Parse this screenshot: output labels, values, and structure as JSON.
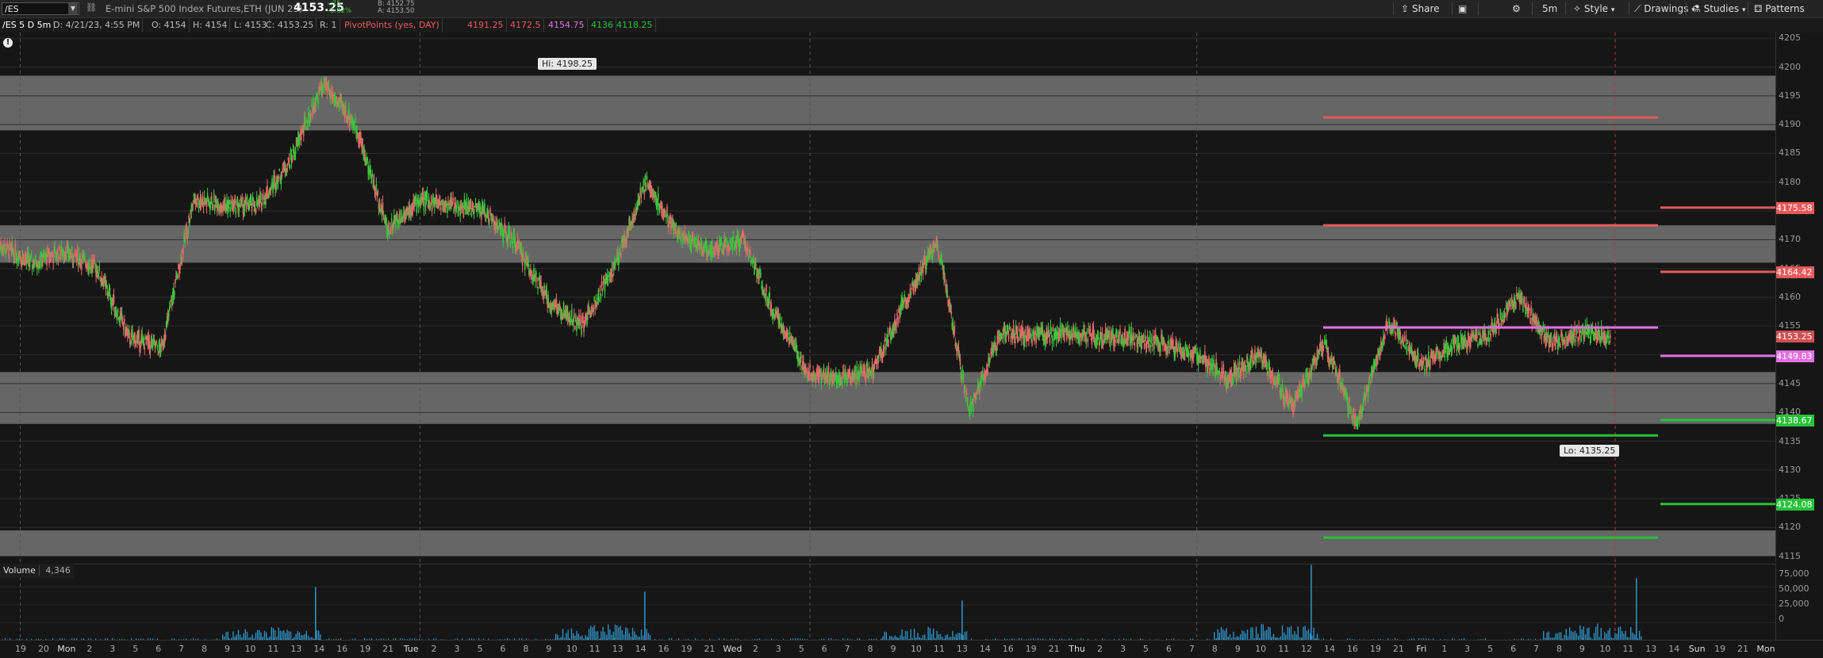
{
  "toolbar": {
    "symbol": "/ES",
    "description": "E-mini S&P 500 Index Futures,ETH (JUN 23)",
    "last": "4153.25",
    "change": "-.75",
    "change_pct": "-0.02%",
    "bid": "B: 4152.75",
    "ask": "A: 4153.50",
    "share": "Share",
    "timeframe": "5m",
    "style": "Style",
    "drawings": "Drawings",
    "studies": "Studies",
    "patterns": "Patterns"
  },
  "infobar": {
    "title": "/ES 5 D 5m",
    "date": "D: 4/21/23, 4:55 PM",
    "open": "O: 4154",
    "high": "H: 4154",
    "low": "L: 4153",
    "close": "C: 4153.25",
    "range": "R: 1",
    "study": "PivotPoints (yes, DAY)",
    "r2": "4191.25",
    "r1": "4172.5",
    "pp": "4154.75",
    "s1": "4136",
    "s2": "4118.25"
  },
  "colors": {
    "up": "#3ec43e",
    "down": "#e26b6b",
    "resistance": "#e85a5a",
    "pivot": "#e070e0",
    "support": "#27c23a",
    "zone": "#6a6a6a",
    "volume": "#2e8fc0"
  },
  "chart_data": {
    "type": "line",
    "title": "/ES 5 D 5m",
    "ylim": [
      4114,
      4206
    ],
    "yticks": [
      4205,
      4200,
      4195,
      4190,
      4185,
      4180,
      4175,
      4170,
      4165,
      4160,
      4155,
      4150,
      4145,
      4140,
      4135,
      4130,
      4125,
      4120,
      4115
    ],
    "x_labels": [
      "19",
      "20",
      "Mon",
      "2",
      "3",
      "5",
      "6",
      "7",
      "8",
      "9",
      "10",
      "11",
      "13",
      "14",
      "16",
      "19",
      "21",
      "Tue",
      "2",
      "3",
      "5",
      "6",
      "8",
      "9",
      "10",
      "11",
      "13",
      "14",
      "16",
      "19",
      "21",
      "Wed",
      "2",
      "3",
      "5",
      "6",
      "7",
      "8",
      "9",
      "10",
      "11",
      "13",
      "14",
      "16",
      "19",
      "21",
      "Thu",
      "2",
      "3",
      "5",
      "6",
      "7",
      "8",
      "9",
      "10",
      "11",
      "12",
      "14",
      "16",
      "19",
      "21",
      "Fri",
      "1",
      "3",
      "5",
      "6",
      "7",
      "8",
      "9",
      "10",
      "11",
      "13",
      "14",
      "Sun",
      "19",
      "21",
      "Mon"
    ],
    "days": [
      "Mon",
      "Tue",
      "Wed",
      "Thu",
      "Fri"
    ],
    "series": [
      {
        "name": "/ES",
        "x": [
          0,
          4,
          8,
          12,
          16,
          20,
          24,
          28,
          32,
          36,
          40,
          44,
          48,
          52,
          56,
          60,
          64,
          68,
          72,
          76,
          80,
          84,
          88,
          92,
          96,
          100
        ],
        "values": [
          4169,
          4166,
          4168,
          4165,
          4153,
          4151,
          4177,
          4176,
          4176,
          4184,
          4197,
          4190,
          4172,
          4177,
          4176,
          4175,
          4169,
          4159,
          4155,
          4165,
          4180,
          4171,
          4168,
          4170,
          4157,
          4147
        ]
      }
    ],
    "series2": {
      "x": [
        100,
        104,
        108,
        112,
        116,
        120,
        124,
        128,
        132,
        136,
        140,
        144,
        148,
        152,
        156,
        160,
        164,
        168,
        172,
        176,
        180,
        184,
        188,
        192,
        196,
        200
      ],
      "values": [
        4147,
        4146,
        4147,
        4159,
        4170,
        4140,
        4154,
        4153,
        4154,
        4153,
        4153,
        4152,
        4150,
        4146,
        4150,
        4141,
        4152,
        4138,
        4156,
        4148,
        4152,
        4153,
        4160,
        4152,
        4154,
        4153
      ]
    },
    "zones": [
      {
        "low": 4189,
        "high": 4198.5
      },
      {
        "low": 4166,
        "high": 4172.5
      },
      {
        "low": 4138,
        "high": 4147
      },
      {
        "low": 4115,
        "high": 4119.5
      }
    ],
    "pivot_levels": [
      {
        "name": "R2",
        "value": 4191.25
      },
      {
        "name": "R1",
        "value": 4172.5
      },
      {
        "name": "PP",
        "value": 4154.75
      },
      {
        "name": "S1",
        "value": 4136
      },
      {
        "name": "S2",
        "value": 4118.25
      }
    ],
    "right_badges": [
      {
        "label": "4175.58",
        "value": 4175.58,
        "kind": "resistance"
      },
      {
        "label": "4164.42",
        "value": 4164.42,
        "kind": "resistance"
      },
      {
        "label": "4153.25",
        "value": 4153.25,
        "kind": "last"
      },
      {
        "label": "4149.83",
        "value": 4149.83,
        "kind": "pivot"
      },
      {
        "label": "4138.67",
        "value": 4138.67,
        "kind": "support"
      },
      {
        "label": "4124.08",
        "value": 4124.08,
        "kind": "support"
      }
    ],
    "annotations": [
      {
        "text": "Hi: 4198.25",
        "value": 4198.25
      },
      {
        "text": "Lo: 4135.25",
        "value": 4135.25
      }
    ],
    "volume": {
      "label": "Volume",
      "last": "4,346",
      "yticks": [
        "75,000",
        "50,000",
        "25,000",
        "0"
      ]
    }
  }
}
